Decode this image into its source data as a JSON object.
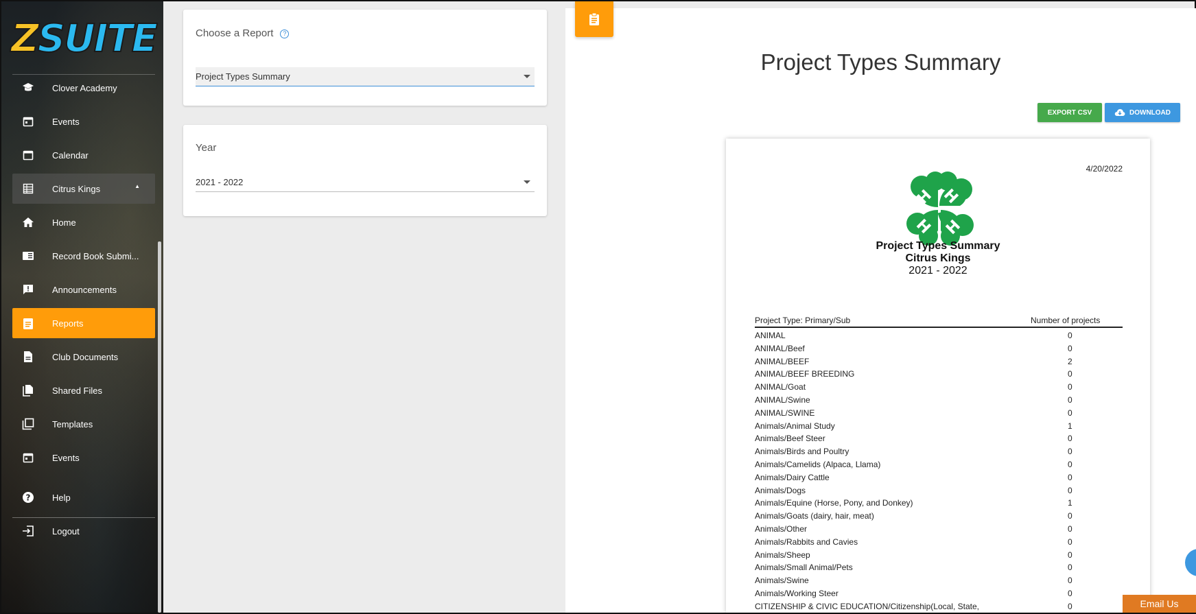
{
  "app": {
    "logo_text_z": "Z",
    "logo_text_rest": "SUITE"
  },
  "sidebar": {
    "items": [
      {
        "label": "Clover Academy",
        "icon": "graduation-cap-icon"
      },
      {
        "label": "Events",
        "icon": "calendar-event-icon"
      },
      {
        "label": "Calendar",
        "icon": "calendar-icon"
      },
      {
        "label": "Citrus Kings",
        "icon": "table-icon",
        "expanded": true
      },
      {
        "label": "Home",
        "icon": "home-icon"
      },
      {
        "label": "Record Book Submi...",
        "icon": "book-icon"
      },
      {
        "label": "Announcements",
        "icon": "announcement-icon"
      },
      {
        "label": "Reports",
        "icon": "clipboard-icon",
        "active": true
      },
      {
        "label": "Club Documents",
        "icon": "document-icon"
      },
      {
        "label": "Shared Files",
        "icon": "files-icon"
      },
      {
        "label": "Templates",
        "icon": "templates-icon"
      },
      {
        "label": "Events",
        "icon": "calendar-event-icon"
      },
      {
        "label": "Help",
        "icon": "help-icon"
      },
      {
        "label": "Logout",
        "icon": "logout-icon"
      }
    ]
  },
  "form": {
    "report_label": "Choose a Report",
    "report_value": "Project Types Summary",
    "year_label": "Year",
    "year_value": "2021 - 2022"
  },
  "report": {
    "title": "Project Types Summary",
    "export_csv": "EXPORT CSV",
    "download": "DOWNLOAD",
    "date": "4/20/2022",
    "heading1": "Project Types Summary",
    "heading2": "Citrus Kings",
    "heading3": "2021 - 2022",
    "col_type": "Project Type: Primary/Sub",
    "col_count": "Number of projects",
    "rows": [
      {
        "type": "ANIMAL",
        "count": "0"
      },
      {
        "type": "ANIMAL/Beef",
        "count": "0"
      },
      {
        "type": "ANIMAL/BEEF",
        "count": "2"
      },
      {
        "type": "ANIMAL/BEEF BREEDING",
        "count": "0"
      },
      {
        "type": "ANIMAL/Goat",
        "count": "0"
      },
      {
        "type": "ANIMAL/Swine",
        "count": "0"
      },
      {
        "type": "ANIMAL/SWINE",
        "count": "0"
      },
      {
        "type": "Animals/Animal Study",
        "count": "1"
      },
      {
        "type": "Animals/Beef Steer",
        "count": "0"
      },
      {
        "type": "Animals/Birds and Poultry",
        "count": "0"
      },
      {
        "type": "Animals/Camelids (Alpaca, Llama)",
        "count": "0"
      },
      {
        "type": "Animals/Dairy Cattle",
        "count": "0"
      },
      {
        "type": "Animals/Dogs",
        "count": "0"
      },
      {
        "type": "Animals/Equine (Horse, Pony, and Donkey)",
        "count": "1"
      },
      {
        "type": "Animals/Goats (dairy, hair, meat)",
        "count": "0"
      },
      {
        "type": "Animals/Other",
        "count": "0"
      },
      {
        "type": "Animals/Rabbits and Cavies",
        "count": "0"
      },
      {
        "type": "Animals/Sheep",
        "count": "0"
      },
      {
        "type": "Animals/Small Animal/Pets",
        "count": "0"
      },
      {
        "type": "Animals/Swine",
        "count": "0"
      },
      {
        "type": "Animals/Working Steer",
        "count": "0"
      },
      {
        "type": "CITIZENSHIP & CIVIC EDUCATION/Citizenship(Local, State, National)",
        "count": "0"
      }
    ]
  },
  "footer": {
    "email_us": "Email Us"
  },
  "colors": {
    "accent": "#ff9c0a",
    "csv_green": "#46a94b",
    "download_blue": "#3d98e0",
    "clover_green": "#1fa34a"
  }
}
